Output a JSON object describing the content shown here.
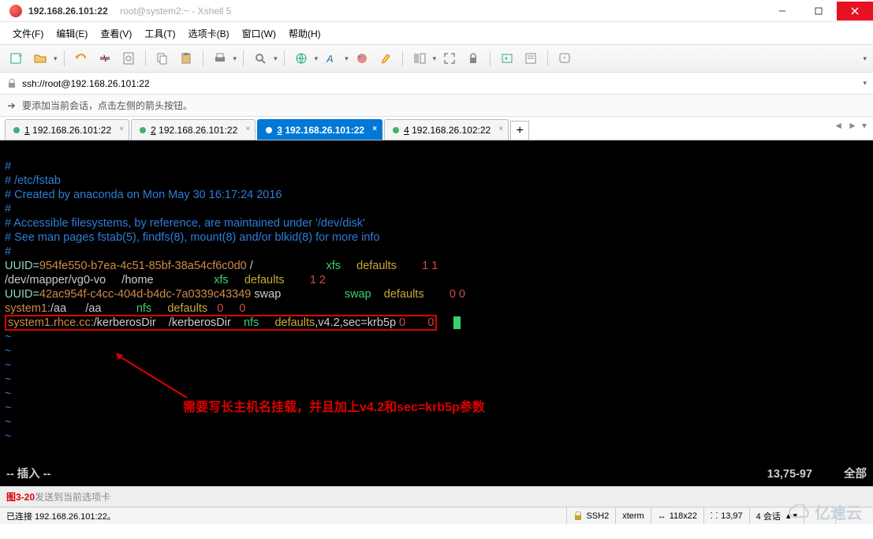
{
  "window": {
    "title_main": "192.168.26.101:22",
    "title_sub": "root@system2:~ - Xshell 5"
  },
  "menu": {
    "file": "文件(F)",
    "edit": "编辑(E)",
    "view": "查看(V)",
    "tools": "工具(T)",
    "tabs": "选项卡(B)",
    "window": "窗口(W)",
    "help": "帮助(H)"
  },
  "address": "ssh://root@192.168.26.101:22",
  "session_hint": "要添加当前会话，点击左侧的箭头按钮。",
  "tabs": [
    {
      "num": "1",
      "label": "192.168.26.101:22"
    },
    {
      "num": "2",
      "label": "192.168.26.101:22"
    },
    {
      "num": "3",
      "label": "192.168.26.101:22"
    },
    {
      "num": "4",
      "label": "192.168.26.102:22"
    }
  ],
  "terminal": {
    "comments": [
      "#",
      "# /etc/fstab",
      "# Created by anaconda on Mon May 30 16:17:24 2016",
      "#",
      "# Accessible filesystems, by reference, are maintained under '/dev/disk'",
      "# See man pages fstab(5), findfs(8), mount(8) and/or blkid(8) for more info",
      "#"
    ],
    "uuid1_key": "UUID=",
    "uuid1_val": "954fe550-b7ea-4c51-85bf-38a54cf6c0d0",
    "uuid1_mnt": " /                       ",
    "uuid1_fs": "xfs     ",
    "uuid1_opt": "defaults        ",
    "uuid1_dump": "1 1",
    "dev2": "/dev/mapper/vg0-vo     /home                   ",
    "dev2_fs": "xfs     ",
    "dev2_opt": "defaults        ",
    "dev2_dump": "1 2",
    "uuid3_key": "UUID=",
    "uuid3_val": "42ac954f-c4cc-404d-b4dc-7a0339c43349",
    "uuid3_mnt": " swap                    ",
    "uuid3_fs": "swap    ",
    "uuid3_opt": "defaults        ",
    "uuid3_dump": "0 0",
    "sys1_host": "system1:",
    "sys1_path": "/aa      /aa           ",
    "sys1_fs": "nfs     ",
    "sys1_opt": "defaults   ",
    "sys1_dump0": "0     ",
    "sys1_dump1": "0",
    "hl_host": "system1.rhce.cc:",
    "hl_path": "/kerberosDir    /kerberosDir    ",
    "hl_fs": "nfs     ",
    "hl_opt1": "defaults",
    "hl_opt2": ",v4.2,sec=krb5p ",
    "hl_dump0": "0       ",
    "hl_dump1": "0",
    "mode": "-- 插入 --",
    "pos": "13,75-97",
    "scroll": "全部"
  },
  "annotation": "需要写长主机名挂载，并且加上v4.2和sec=krb5p参数",
  "footer": {
    "figure": "图3-20",
    "input_hint": "发送到当前选项卡"
  },
  "statusbar": {
    "connected": "已连接 192.168.26.101:22。",
    "ssh": "SSH2",
    "term": "xterm",
    "size": "118x22",
    "cursor": "13,97",
    "sessions": "4 会话"
  },
  "tabnav": {
    "left": "◄",
    "right": "►",
    "menu": "▾"
  },
  "watermark": "亿速云"
}
